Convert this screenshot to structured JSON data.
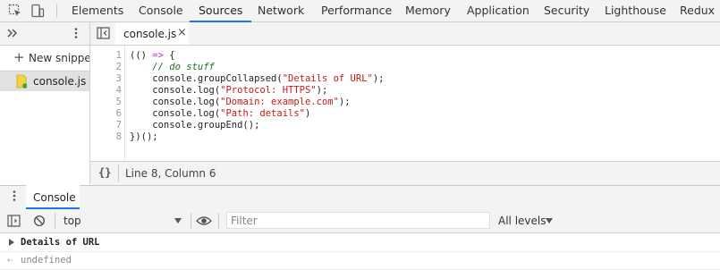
{
  "topbar": {
    "tabs": [
      "Elements",
      "Console",
      "Sources",
      "Network",
      "Performance",
      "Memory",
      "Application",
      "Security",
      "Lighthouse",
      "Redux"
    ],
    "active_tab": "Sources",
    "accent": "#1a73e8"
  },
  "navigator": {
    "new_snippet": "New snippet",
    "snippet_file": "console.js"
  },
  "editor": {
    "open_tab": "console.js",
    "close_glyph": "×",
    "line_numbers": [
      "1",
      "2",
      "3",
      "4",
      "5",
      "6",
      "7",
      "8"
    ],
    "lines": [
      {
        "parts": [
          {
            "t": "(() ",
            "c": "plain"
          },
          {
            "t": "=>",
            "c": "op"
          },
          {
            "t": " {",
            "c": "plain"
          }
        ]
      },
      {
        "parts": [
          {
            "t": "    ",
            "c": "plain"
          },
          {
            "t": "// do stuff",
            "c": "cmt"
          }
        ]
      },
      {
        "parts": [
          {
            "t": "    console.groupCollapsed(",
            "c": "plain"
          },
          {
            "t": "\"Details of URL\"",
            "c": "str"
          },
          {
            "t": ");",
            "c": "plain"
          }
        ]
      },
      {
        "parts": [
          {
            "t": "    console.log(",
            "c": "plain"
          },
          {
            "t": "\"Protocol: HTTPS\"",
            "c": "str"
          },
          {
            "t": ");",
            "c": "plain"
          }
        ]
      },
      {
        "parts": [
          {
            "t": "    console.log(",
            "c": "plain"
          },
          {
            "t": "\"Domain: example.com\"",
            "c": "str"
          },
          {
            "t": ");",
            "c": "plain"
          }
        ]
      },
      {
        "parts": [
          {
            "t": "    console.log(",
            "c": "plain"
          },
          {
            "t": "\"Path: details\"",
            "c": "str"
          },
          {
            "t": ")",
            "c": "plain"
          }
        ]
      },
      {
        "parts": [
          {
            "t": "    console.groupEnd();",
            "c": "plain"
          }
        ]
      },
      {
        "parts": [
          {
            "t": "})();",
            "c": "plain"
          }
        ]
      }
    ],
    "status_icon": "{}",
    "cursor_position": "Line 8, Column 6"
  },
  "drawer": {
    "tab": "Console",
    "context": "top",
    "filter_placeholder": "Filter",
    "levels": "All levels",
    "messages": [
      {
        "text": "Details of URL",
        "kind": "group"
      },
      {
        "text": "undefined",
        "kind": "result"
      }
    ]
  }
}
